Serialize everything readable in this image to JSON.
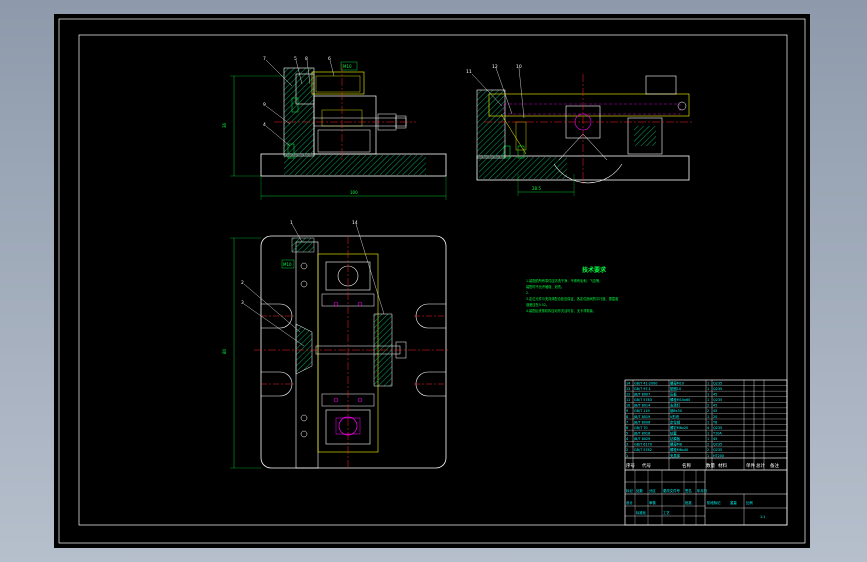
{
  "canvas": {
    "background": "#000000",
    "outer_background": "#9aa4b3"
  },
  "colors": {
    "frame": "#ffffff",
    "outline": "#ffffff",
    "hatch": "#00a060",
    "center": "#ff2020",
    "hidden": "#ffff00",
    "dimension": "#00ff40",
    "part_accent": "#ff00ff",
    "table_text": "#00ffff"
  },
  "front_view": {
    "callouts": [
      "7",
      "5",
      "8",
      "6",
      "9",
      "4"
    ],
    "dim_height": "36",
    "dim_width": "100",
    "label_box": "M10"
  },
  "side_view": {
    "callouts": [
      "11",
      "12",
      "10"
    ],
    "dim_width": "28.5"
  },
  "plan_view": {
    "callouts": [
      "1",
      "2",
      "3",
      "14"
    ],
    "dim_height": "80",
    "label_box": "M10"
  },
  "technical_requirements": {
    "title": "技术要求",
    "lines": [
      "1.装配前所有零件应清洗干净，不得有毛刺、飞边等，",
      "  装配时不允许磕碰、划伤。",
      "2.",
      "3.定位元件与夹具体配合处应保证，各定位面间的平行度、垂直度",
      "  误差应在0.02。",
      "4.装配后夹紧机构应动作灵活可靠，无卡滞现象。"
    ]
  },
  "title_block": {
    "headers": [
      "序号",
      "代号",
      "名称",
      "数量",
      "材料",
      "单件",
      "总计",
      "备注"
    ],
    "rows": [
      [
        "14",
        "GB/T 41-2000",
        "螺母M10",
        "1",
        "Q235"
      ],
      [
        "13",
        "GB/T 97.1",
        "垫圈10",
        "1",
        "Q235"
      ],
      [
        "12",
        "JB/T 8007",
        "压板",
        "1",
        "45"
      ],
      [
        "11",
        "GB/T 5783",
        "螺栓M10x60",
        "1",
        "Q235"
      ],
      [
        "10",
        "JB/T 8014",
        "支承钉",
        "2",
        "45"
      ],
      [
        "9",
        "GB/T 119",
        "销8x30",
        "2",
        "45"
      ],
      [
        "8",
        "JB/T 8019",
        "V形块",
        "1",
        "20"
      ],
      [
        "7",
        "JB/T 8006",
        "定位销",
        "1",
        "T8"
      ],
      [
        "6",
        "GB/T 70",
        "螺钉M6x20",
        "4",
        "Q235"
      ],
      [
        "5",
        "JB/T 8018",
        "钻套",
        "1",
        "T10A"
      ],
      [
        "4",
        "JB/T 8029",
        "钻模板",
        "1",
        "45"
      ],
      [
        "3",
        "GB/T 6170",
        "螺母M8",
        "2",
        "Q235"
      ],
      [
        "2",
        "GB/T 5782",
        "螺栓M8x40",
        "2",
        "Q235"
      ],
      [
        "1",
        "",
        "夹具体",
        "1",
        "HT200"
      ]
    ],
    "sign_labels": [
      "标记",
      "处数",
      "分区",
      "更改文件号",
      "签名",
      "年月日"
    ],
    "bottom_labels": [
      "设计",
      "标准化",
      "审核",
      "工艺",
      "批准"
    ],
    "scale_labels": [
      "阶段标记",
      "重量",
      "比例"
    ],
    "scale_values": [
      "1:1"
    ]
  }
}
